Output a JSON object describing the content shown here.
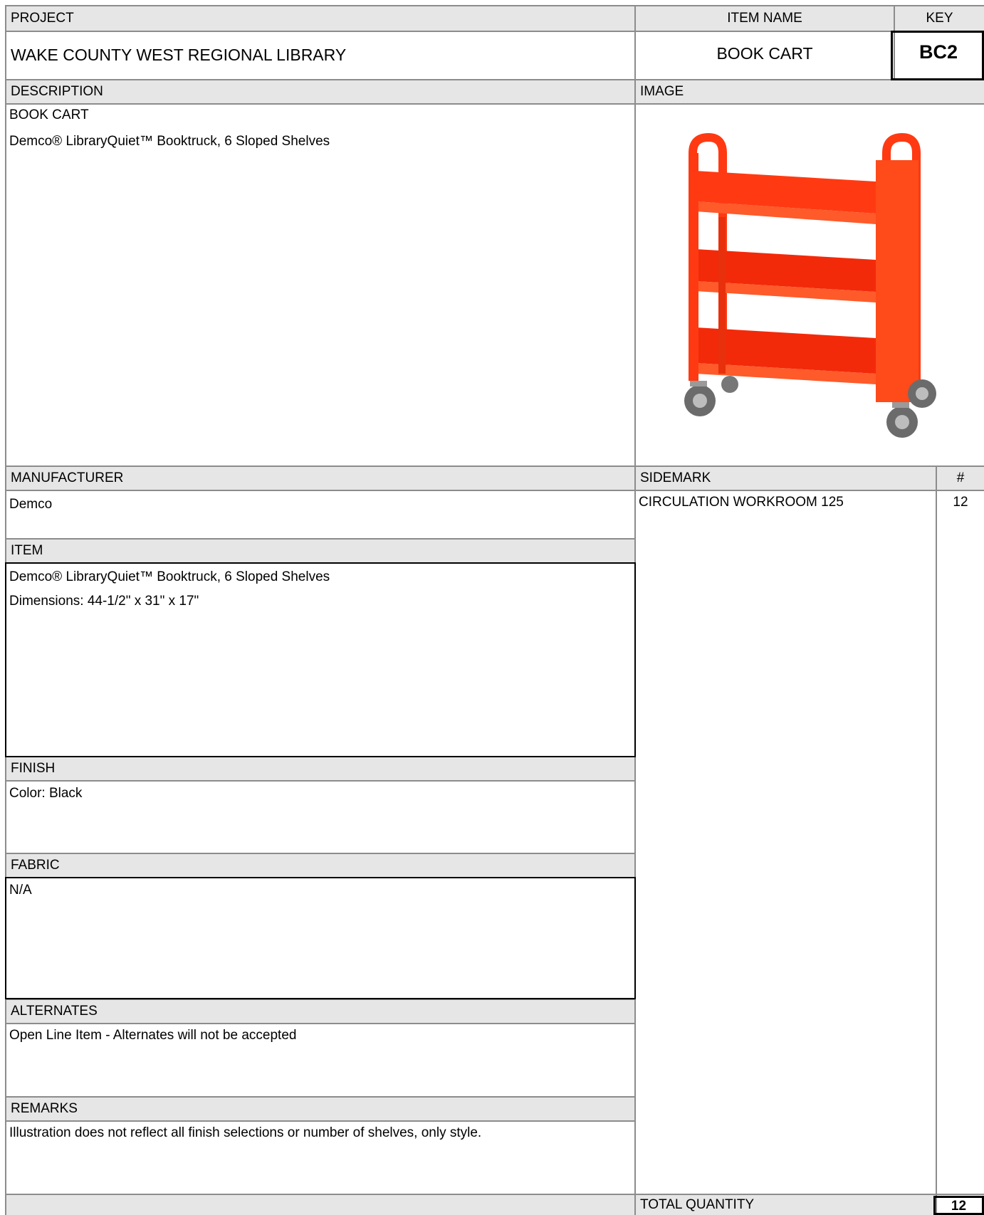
{
  "header": {
    "project_label": "PROJECT",
    "item_name_label": "ITEM NAME",
    "key_label": "KEY",
    "project_value": "WAKE COUNTY WEST REGIONAL LIBRARY",
    "item_name_value": "BOOK CART",
    "key_value": "BC2"
  },
  "description": {
    "label": "DESCRIPTION",
    "line1": "BOOK CART",
    "line2": "Demco® LibraryQuiet™ Booktruck, 6 Sloped Shelves"
  },
  "image": {
    "label": "IMAGE",
    "cart_color": "#ff3a12"
  },
  "manufacturer": {
    "label": "MANUFACTURER",
    "value": "Demco"
  },
  "sidemark": {
    "label": "SIDEMARK",
    "count_label": "#",
    "value": "CIRCULATION WORKROOM 125",
    "count": "12"
  },
  "item": {
    "label": "ITEM",
    "line1": "Demco® LibraryQuiet™ Booktruck, 6 Sloped Shelves",
    "line2": "Dimensions: 44-1/2\" x 31\" x 17\""
  },
  "finish": {
    "label": "FINISH",
    "value": "Color: Black"
  },
  "fabric": {
    "label": "FABRIC",
    "value": "N/A"
  },
  "alternates": {
    "label": "ALTERNATES",
    "value": "Open Line Item - Alternates will not be accepted"
  },
  "remarks": {
    "label": "REMARKS",
    "value": "Illustration does not reflect all finish selections or number of shelves, only style."
  },
  "total": {
    "label": "TOTAL QUANTITY",
    "value": "12"
  },
  "colors": {
    "header_fill": "#e6e6e6",
    "rule": "#8c8c8c"
  }
}
